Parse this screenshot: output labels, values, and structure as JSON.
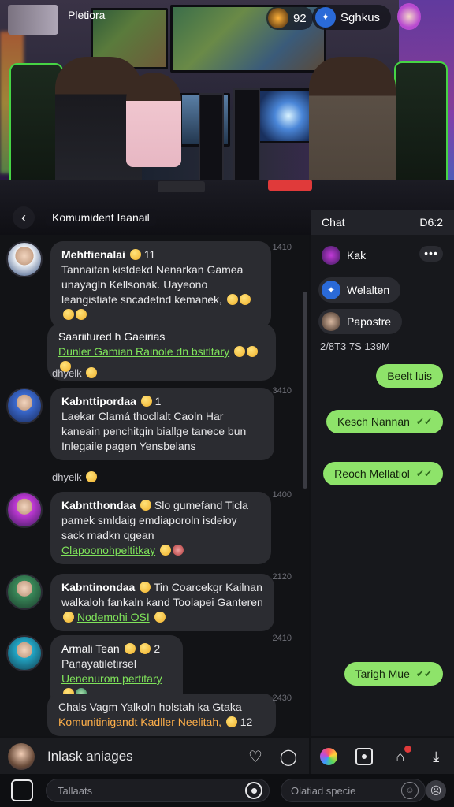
{
  "hero": {
    "left_label": "Pletiora",
    "mid_chip": "92",
    "right_chip": "Sghkus",
    "back_label": "Komumident Iaanail"
  },
  "messages": [
    {
      "name": "Mehtfienalai",
      "badge": "11",
      "text": "Tannaitan kistdekd Nenarkan Gamea unayagln Kellsonak. Uayeono leangistiate sncadetnd kemanek,",
      "time": "1410"
    },
    {
      "name": "Saariitured h Gaeirias",
      "text": "Dunler Gamian Rainole dn bsitltary",
      "time": ""
    },
    {
      "plain": "dhyelk"
    },
    {
      "name": "Kabnttipordaa",
      "badge": "1",
      "text": "Laekar Clamá thocllalt Caoln Har kaneain penchitgin biallge tanece bun Inlegaile pagen Yensbelans",
      "time": "3410"
    },
    {
      "plain": "dhyelk"
    },
    {
      "name": "Kabntthondaa",
      "text": "Slo gumefand Ticla pamek smldaig emdiaporoln isdeioy sack madkn qgean",
      "link": "Clapoonohpeltitkay",
      "time": "1400"
    },
    {
      "name": "Kabntinondaa",
      "text": "Tin Coarcekgr Kailnan walkaloh fankaln kand Toolapei Ganteren",
      "link": "Nodemohi OSI",
      "time": "2120"
    },
    {
      "name": "Armali Tean",
      "badge": "2",
      "text": "Panayatiletirsel",
      "link": "Uenenurom pertitary",
      "time": "2410"
    },
    {
      "name": "Chals Vagm Yalkoln holstah ka Gtaka",
      "text": "Komunitinigandt Kadller Neelitah,",
      "badge": "12",
      "time": "2430"
    }
  ],
  "right": {
    "header_title": "Chat",
    "header_code": "D6:2",
    "items": [
      "Kak",
      "Welalten",
      "Papostre"
    ],
    "more": "•••",
    "timestamp": "2/8T3 7S 139M",
    "bubbles": [
      "Beelt luis",
      "Kesch Nannan",
      "Reoch Mellatiol",
      "Tarigh Mue"
    ]
  },
  "compose": {
    "placeholder": "Inlask aniages"
  },
  "footer": {
    "input1": "Tallaats",
    "input2": "Olatiad specie"
  }
}
